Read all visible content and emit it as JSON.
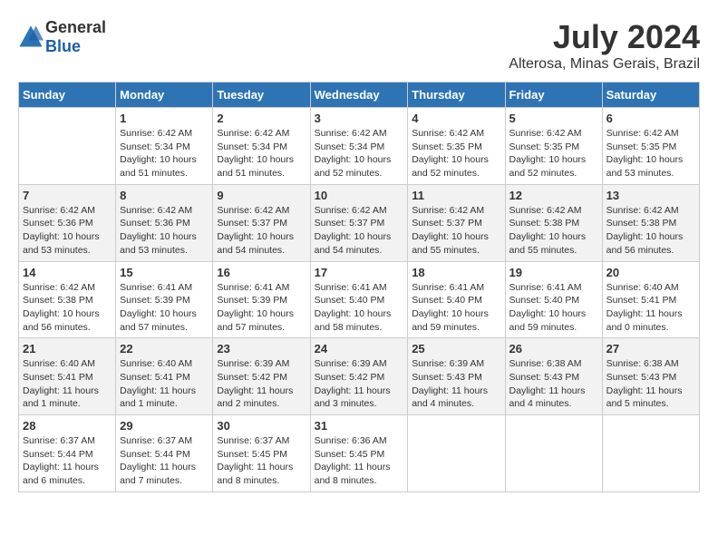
{
  "logo": {
    "text_general": "General",
    "text_blue": "Blue"
  },
  "title": "July 2024",
  "subtitle": "Alterosa, Minas Gerais, Brazil",
  "days_header": [
    "Sunday",
    "Monday",
    "Tuesday",
    "Wednesday",
    "Thursday",
    "Friday",
    "Saturday"
  ],
  "weeks": [
    [
      {
        "day": "",
        "info": ""
      },
      {
        "day": "1",
        "info": "Sunrise: 6:42 AM\nSunset: 5:34 PM\nDaylight: 10 hours\nand 51 minutes."
      },
      {
        "day": "2",
        "info": "Sunrise: 6:42 AM\nSunset: 5:34 PM\nDaylight: 10 hours\nand 51 minutes."
      },
      {
        "day": "3",
        "info": "Sunrise: 6:42 AM\nSunset: 5:34 PM\nDaylight: 10 hours\nand 52 minutes."
      },
      {
        "day": "4",
        "info": "Sunrise: 6:42 AM\nSunset: 5:35 PM\nDaylight: 10 hours\nand 52 minutes."
      },
      {
        "day": "5",
        "info": "Sunrise: 6:42 AM\nSunset: 5:35 PM\nDaylight: 10 hours\nand 52 minutes."
      },
      {
        "day": "6",
        "info": "Sunrise: 6:42 AM\nSunset: 5:35 PM\nDaylight: 10 hours\nand 53 minutes."
      }
    ],
    [
      {
        "day": "7",
        "info": "Sunrise: 6:42 AM\nSunset: 5:36 PM\nDaylight: 10 hours\nand 53 minutes."
      },
      {
        "day": "8",
        "info": "Sunrise: 6:42 AM\nSunset: 5:36 PM\nDaylight: 10 hours\nand 53 minutes."
      },
      {
        "day": "9",
        "info": "Sunrise: 6:42 AM\nSunset: 5:37 PM\nDaylight: 10 hours\nand 54 minutes."
      },
      {
        "day": "10",
        "info": "Sunrise: 6:42 AM\nSunset: 5:37 PM\nDaylight: 10 hours\nand 54 minutes."
      },
      {
        "day": "11",
        "info": "Sunrise: 6:42 AM\nSunset: 5:37 PM\nDaylight: 10 hours\nand 55 minutes."
      },
      {
        "day": "12",
        "info": "Sunrise: 6:42 AM\nSunset: 5:38 PM\nDaylight: 10 hours\nand 55 minutes."
      },
      {
        "day": "13",
        "info": "Sunrise: 6:42 AM\nSunset: 5:38 PM\nDaylight: 10 hours\nand 56 minutes."
      }
    ],
    [
      {
        "day": "14",
        "info": "Sunrise: 6:42 AM\nSunset: 5:38 PM\nDaylight: 10 hours\nand 56 minutes."
      },
      {
        "day": "15",
        "info": "Sunrise: 6:41 AM\nSunset: 5:39 PM\nDaylight: 10 hours\nand 57 minutes."
      },
      {
        "day": "16",
        "info": "Sunrise: 6:41 AM\nSunset: 5:39 PM\nDaylight: 10 hours\nand 57 minutes."
      },
      {
        "day": "17",
        "info": "Sunrise: 6:41 AM\nSunset: 5:40 PM\nDaylight: 10 hours\nand 58 minutes."
      },
      {
        "day": "18",
        "info": "Sunrise: 6:41 AM\nSunset: 5:40 PM\nDaylight: 10 hours\nand 59 minutes."
      },
      {
        "day": "19",
        "info": "Sunrise: 6:41 AM\nSunset: 5:40 PM\nDaylight: 10 hours\nand 59 minutes."
      },
      {
        "day": "20",
        "info": "Sunrise: 6:40 AM\nSunset: 5:41 PM\nDaylight: 11 hours\nand 0 minutes."
      }
    ],
    [
      {
        "day": "21",
        "info": "Sunrise: 6:40 AM\nSunset: 5:41 PM\nDaylight: 11 hours\nand 1 minute."
      },
      {
        "day": "22",
        "info": "Sunrise: 6:40 AM\nSunset: 5:41 PM\nDaylight: 11 hours\nand 1 minute."
      },
      {
        "day": "23",
        "info": "Sunrise: 6:39 AM\nSunset: 5:42 PM\nDaylight: 11 hours\nand 2 minutes."
      },
      {
        "day": "24",
        "info": "Sunrise: 6:39 AM\nSunset: 5:42 PM\nDaylight: 11 hours\nand 3 minutes."
      },
      {
        "day": "25",
        "info": "Sunrise: 6:39 AM\nSunset: 5:43 PM\nDaylight: 11 hours\nand 4 minutes."
      },
      {
        "day": "26",
        "info": "Sunrise: 6:38 AM\nSunset: 5:43 PM\nDaylight: 11 hours\nand 4 minutes."
      },
      {
        "day": "27",
        "info": "Sunrise: 6:38 AM\nSunset: 5:43 PM\nDaylight: 11 hours\nand 5 minutes."
      }
    ],
    [
      {
        "day": "28",
        "info": "Sunrise: 6:37 AM\nSunset: 5:44 PM\nDaylight: 11 hours\nand 6 minutes."
      },
      {
        "day": "29",
        "info": "Sunrise: 6:37 AM\nSunset: 5:44 PM\nDaylight: 11 hours\nand 7 minutes."
      },
      {
        "day": "30",
        "info": "Sunrise: 6:37 AM\nSunset: 5:45 PM\nDaylight: 11 hours\nand 8 minutes."
      },
      {
        "day": "31",
        "info": "Sunrise: 6:36 AM\nSunset: 5:45 PM\nDaylight: 11 hours\nand 8 minutes."
      },
      {
        "day": "",
        "info": ""
      },
      {
        "day": "",
        "info": ""
      },
      {
        "day": "",
        "info": ""
      }
    ]
  ]
}
